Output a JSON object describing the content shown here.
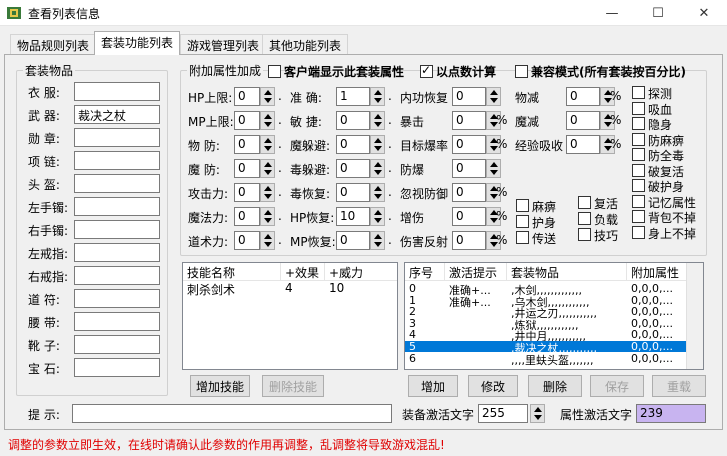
{
  "window": {
    "title": "查看列表信息",
    "min": "—",
    "max": "☐",
    "close": "✕"
  },
  "tabs": [
    {
      "label": "物品规则列表"
    },
    {
      "label": "套装功能列表"
    },
    {
      "label": "游戏管理列表"
    },
    {
      "label": "其他功能列表"
    }
  ],
  "suit": {
    "legend": "套装物品",
    "slots": [
      {
        "label": "衣  服:",
        "value": ""
      },
      {
        "label": "武  器:",
        "value": "裁决之杖"
      },
      {
        "label": "勋  章:",
        "value": ""
      },
      {
        "label": "项  链:",
        "value": ""
      },
      {
        "label": "头  盔:",
        "value": ""
      },
      {
        "label": "左手镯:",
        "value": ""
      },
      {
        "label": "右手镯:",
        "value": ""
      },
      {
        "label": "左戒指:",
        "value": ""
      },
      {
        "label": "右戒指:",
        "value": ""
      },
      {
        "label": "道  符:",
        "value": ""
      },
      {
        "label": "腰  带:",
        "value": ""
      },
      {
        "label": "靴  子:",
        "value": ""
      },
      {
        "label": "宝  石:",
        "value": ""
      }
    ]
  },
  "attr": {
    "legend": "附加属性加成",
    "client_label": "客户端显示此套装属性",
    "point_label": "以点数计算",
    "compat_label": "兼容模式(所有套装按百分比)",
    "col1": [
      {
        "label": "HP上限:",
        "value": "0"
      },
      {
        "label": "MP上限:",
        "value": "0"
      },
      {
        "label": "物  防:",
        "value": "0"
      },
      {
        "label": "魔  防:",
        "value": "0"
      },
      {
        "label": "攻击力:",
        "value": "0"
      },
      {
        "label": "魔法力:",
        "value": "0"
      },
      {
        "label": "道术力:",
        "value": "0"
      }
    ],
    "col2": [
      {
        "label": "准  确:",
        "value": "1"
      },
      {
        "label": "敏  捷:",
        "value": "0"
      },
      {
        "label": "魔躲避:",
        "value": "0"
      },
      {
        "label": "毒躲避:",
        "value": "0"
      },
      {
        "label": "毒恢复:",
        "value": "0"
      },
      {
        "label": "HP恢复:",
        "value": "10"
      },
      {
        "label": "MP恢复:",
        "value": "0"
      }
    ],
    "col3": [
      {
        "label": "内功恢复",
        "value": "0",
        "pct": ""
      },
      {
        "label": "暴击",
        "value": "0",
        "pct": "%"
      },
      {
        "label": "目标爆率",
        "value": "0",
        "pct": "%"
      },
      {
        "label": "防爆",
        "value": "0",
        "pct": ""
      },
      {
        "label": "忽视防御",
        "value": "0",
        "pct": "%"
      },
      {
        "label": "增伤",
        "value": "0",
        "pct": "%"
      },
      {
        "label": "伤害反射",
        "value": "0",
        "pct": "%"
      }
    ],
    "col4": [
      {
        "label": "物减",
        "value": "0",
        "pct": "%"
      },
      {
        "label": "魔减",
        "value": "0",
        "pct": "%"
      },
      {
        "label": "经验吸收",
        "value": "0",
        "pct": "%"
      }
    ],
    "checks_a": [
      {
        "label": "麻痹"
      },
      {
        "label": "护身"
      },
      {
        "label": "传送"
      }
    ],
    "checks_b": [
      {
        "label": "复活"
      },
      {
        "label": "负载"
      },
      {
        "label": "技巧"
      }
    ],
    "checks_c": [
      {
        "label": "探测"
      },
      {
        "label": "吸血"
      },
      {
        "label": "隐身"
      },
      {
        "label": "防麻痹"
      },
      {
        "label": "防全毒"
      },
      {
        "label": "破复活"
      },
      {
        "label": "破护身"
      },
      {
        "label": "记忆属性"
      },
      {
        "label": "背包不掉"
      },
      {
        "label": "身上不掉"
      }
    ]
  },
  "skills": {
    "headers": [
      "技能名称",
      "+效果",
      "+威力"
    ],
    "rows": [
      [
        "刺杀剑术",
        "4",
        "10"
      ]
    ],
    "add": "增加技能",
    "del": "删除技能"
  },
  "suits": {
    "headers": [
      "序号",
      "激活提示",
      "套装物品",
      "附加属性"
    ],
    "rows": [
      [
        "0",
        "准确+...",
        ",木剑,,,,,,,,,,,,,",
        "0,0,0,..."
      ],
      [
        "1",
        "准确+...",
        ",乌木剑,,,,,,,,,,,,",
        "0,0,0,..."
      ],
      [
        "2",
        "",
        ",井运之刃,,,,,,,,,,,",
        "0,0,0,..."
      ],
      [
        "3",
        "",
        ",炼狱,,,,,,,,,,,,",
        "0,0,0,..."
      ],
      [
        "4",
        "",
        ",井中月,,,,,,,,,,,",
        "0,0,0,..."
      ],
      [
        "5",
        "",
        ",裁决之杖,,,,,,,,,,,",
        "0,0,0,..."
      ],
      [
        "6",
        "",
        ",,,,里蚨头盔,,,,,,,",
        "0,0,0,..."
      ]
    ],
    "add": "增加",
    "edit": "修改",
    "del": "删除",
    "save": "保存",
    "reload": "重载"
  },
  "hint": {
    "label": "提  示:",
    "value": ""
  },
  "equip_text": {
    "label": "装备激活文字",
    "value": "255"
  },
  "attr_text": {
    "label": "属性激活文字",
    "value": "239"
  },
  "warning": "调整的参数立即生效，在线时请确认此参数的作用再调整，乱调整将导致游戏混乱!",
  "colors": {
    "warning": "#e00000",
    "selection": "#0078d7",
    "swatch": "#c8b4f0"
  }
}
